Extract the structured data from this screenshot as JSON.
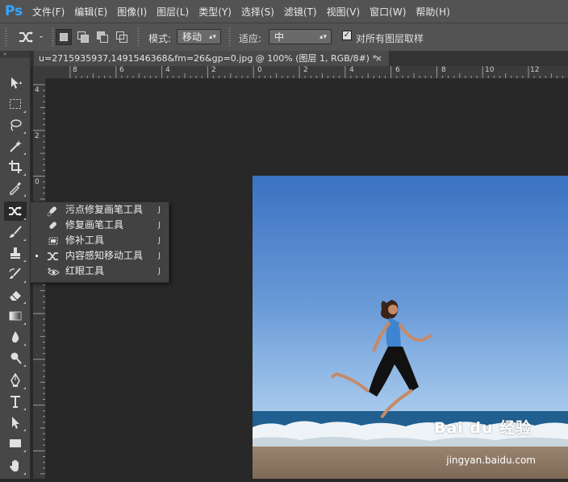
{
  "app": {
    "logo_text": "Ps"
  },
  "menu": [
    "文件(F)",
    "编辑(E)",
    "图像(I)",
    "图层(L)",
    "类型(Y)",
    "选择(S)",
    "滤镜(T)",
    "视图(V)",
    "窗口(W)",
    "帮助(H)"
  ],
  "options_bar": {
    "mode_label": "模式:",
    "mode_value": "移动",
    "adapt_label": "适应:",
    "adapt_value": "中",
    "sample_all_layers_label": "对所有图层取样",
    "sample_all_layers_checked": true
  },
  "document_tab": {
    "title": "u=2715935937,1491546368&fm=26&gp=0.jpg @ 100% (图层 1, RGB/8#) *",
    "close_glyph": "×"
  },
  "toolbar": {
    "collapse_glyph": "»"
  },
  "ruler_top_labels": [
    "8",
    "6",
    "4",
    "2",
    "0",
    "2",
    "4",
    "6",
    "8",
    "10",
    "12"
  ],
  "ruler_left_labels": [
    "4",
    "2",
    "0",
    "2",
    "4"
  ],
  "flyout": {
    "items": [
      {
        "label": "污点修复画笔工具",
        "shortcut": "J",
        "icon": "spot-healing-brush-icon",
        "selected": false
      },
      {
        "label": "修复画笔工具",
        "shortcut": "J",
        "icon": "healing-brush-icon",
        "selected": false
      },
      {
        "label": "修补工具",
        "shortcut": "J",
        "icon": "patch-icon",
        "selected": false
      },
      {
        "label": "内容感知移动工具",
        "shortcut": "J",
        "icon": "content-aware-move-icon",
        "selected": true
      },
      {
        "label": "红眼工具",
        "shortcut": "J",
        "icon": "red-eye-icon",
        "selected": false
      }
    ]
  },
  "watermark": {
    "logo_text": "Bai du 经验",
    "url_text": "jingyan.baidu.com"
  },
  "colors": {
    "sky_top": "#3f77c4",
    "sky_bottom": "#9cc3ea",
    "sea": "#1f5d8c",
    "sand": "#8c7663"
  }
}
